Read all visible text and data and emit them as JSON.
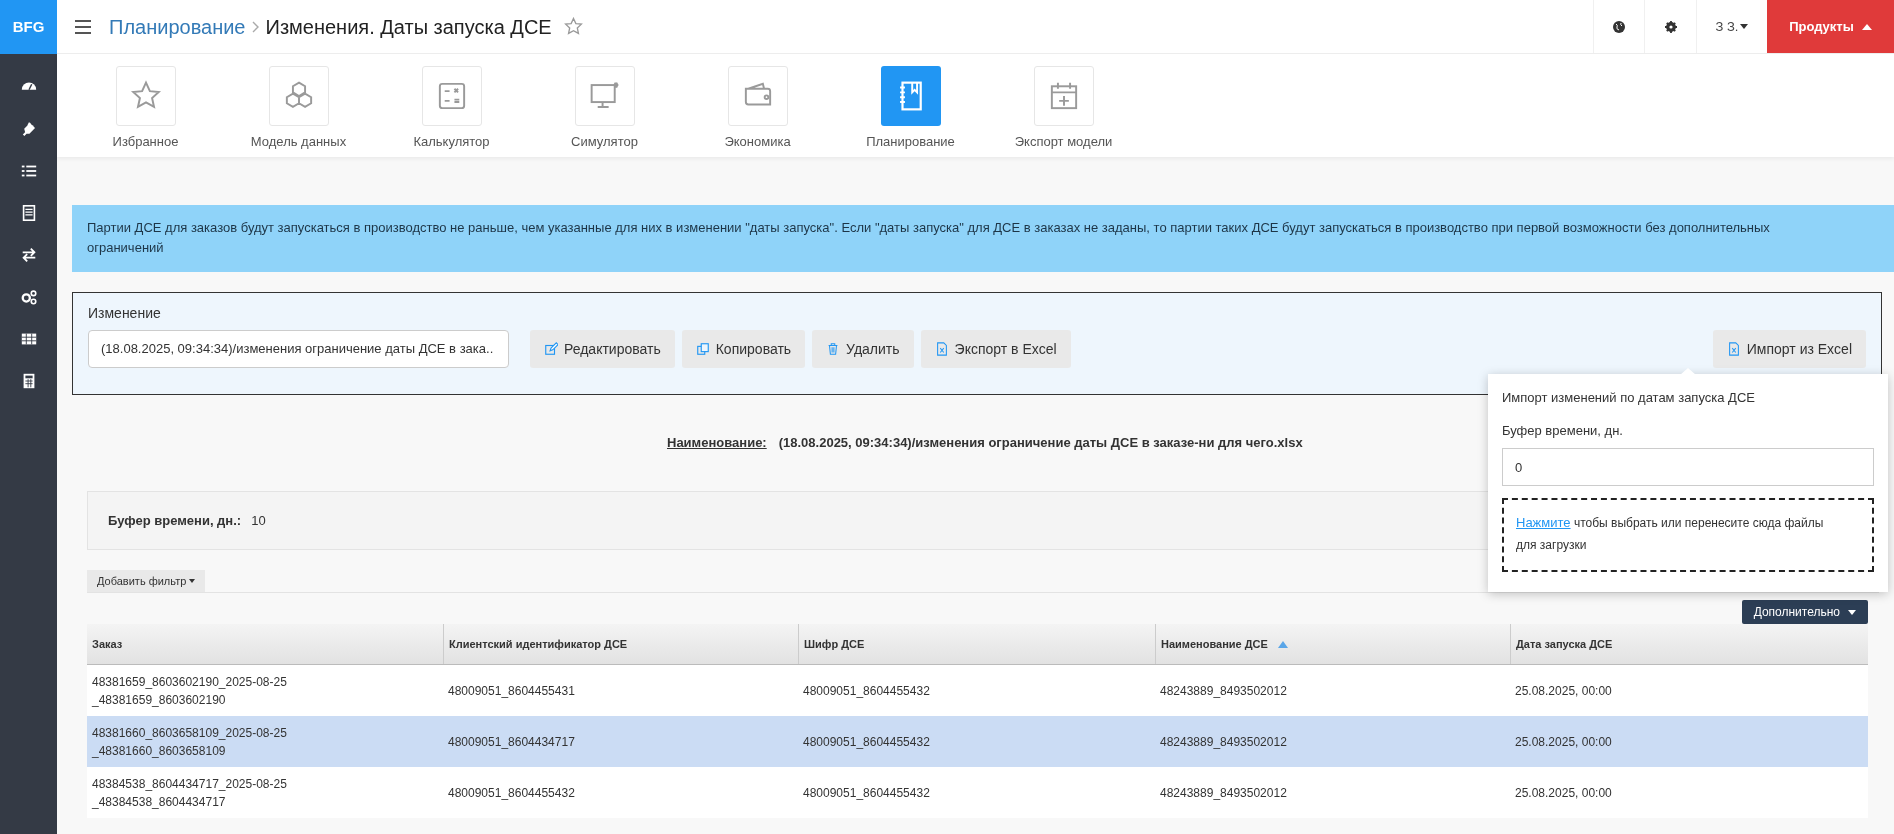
{
  "logo": "BFG",
  "breadcrumb": {
    "parent": "Планирование",
    "current": "Изменения. Даты запуска ДСЕ",
    "favorite": false
  },
  "header": {
    "user": "З З.",
    "products": "Продукты"
  },
  "modules": [
    {
      "label": "Избранное",
      "kind": "star",
      "selected": false
    },
    {
      "label": "Модель данных",
      "kind": "cubes",
      "selected": false
    },
    {
      "label": "Калькулятор",
      "kind": "calculator",
      "selected": false
    },
    {
      "label": "Симулятор",
      "kind": "monitor",
      "selected": false
    },
    {
      "label": "Экономика",
      "kind": "wallet",
      "selected": false
    },
    {
      "label": "Планирование",
      "kind": "notebook",
      "selected": true
    },
    {
      "label": "Экспорт модели",
      "kind": "calendar",
      "selected": false
    }
  ],
  "notice": "Партии ДСЕ для заказов будут запускаться в производство не раньше, чем указанные для них в изменении \"даты запуска\". Если \"даты запуска\" для ДСЕ в заказах не заданы, то партии таких ДСЕ будут запускаться в производство при первой возможности без дополнительных ограничений",
  "change_panel": {
    "label": "Изменение",
    "select_value": "(18.08.2025, 09:34:34)/изменения ограничение даты ДСЕ в зака..",
    "buttons": [
      {
        "label": "Редактировать",
        "kind": "edit"
      },
      {
        "label": "Копировать",
        "kind": "copy"
      },
      {
        "label": "Удалить",
        "kind": "delete"
      },
      {
        "label": "Экспорт в Excel",
        "kind": "excel"
      }
    ],
    "import_button": "Импорт из Excel"
  },
  "name_line": {
    "label": "Наименование:",
    "value": "(18.08.2025, 09:34:34)/изменения ограничение даты ДСЕ в заказе-ни для чего.xlsx"
  },
  "buffer": {
    "label": "Буфер времени, дн.:",
    "value": "10"
  },
  "add_filter": "Добавить фильтр",
  "more_button": "Дополнительно",
  "table": {
    "columns": [
      {
        "label": "Заказ",
        "sorted": false
      },
      {
        "label": "Клиентский идентификатор ДСЕ",
        "sorted": false
      },
      {
        "label": "Шифр ДСЕ",
        "sorted": false
      },
      {
        "label": "Наименование ДСЕ",
        "sorted": true
      },
      {
        "label": "Дата запуска ДСЕ",
        "sorted": false
      }
    ],
    "rows": [
      {
        "selected": false,
        "cells": [
          "48381659_8603602190_2025-08-25_48381659_8603602190",
          "48009051_8604455431",
          "48009051_8604455432",
          "48243889_8493502012",
          "25.08.2025, 00:00"
        ]
      },
      {
        "selected": true,
        "cells": [
          "48381660_8603658109_2025-08-25_48381660_8603658109",
          "48009051_8604434717",
          "48009051_8604455432",
          "48243889_8493502012",
          "25.08.2025, 00:00"
        ]
      },
      {
        "selected": false,
        "cells": [
          "48384538_8604434717_2025-08-25_48384538_8604434717",
          "48009051_8604455432",
          "48009051_8604455432",
          "48243889_8493502012",
          "25.08.2025, 00:00"
        ]
      }
    ]
  },
  "import_popover": {
    "title": "Импорт изменений по датам запуска ДСЕ",
    "field_label": "Буфер времени, дн.",
    "value": "0",
    "link": "Нажмите",
    "drop_text": "чтобы выбрать или перенесите сюда файлы для загрузки"
  }
}
